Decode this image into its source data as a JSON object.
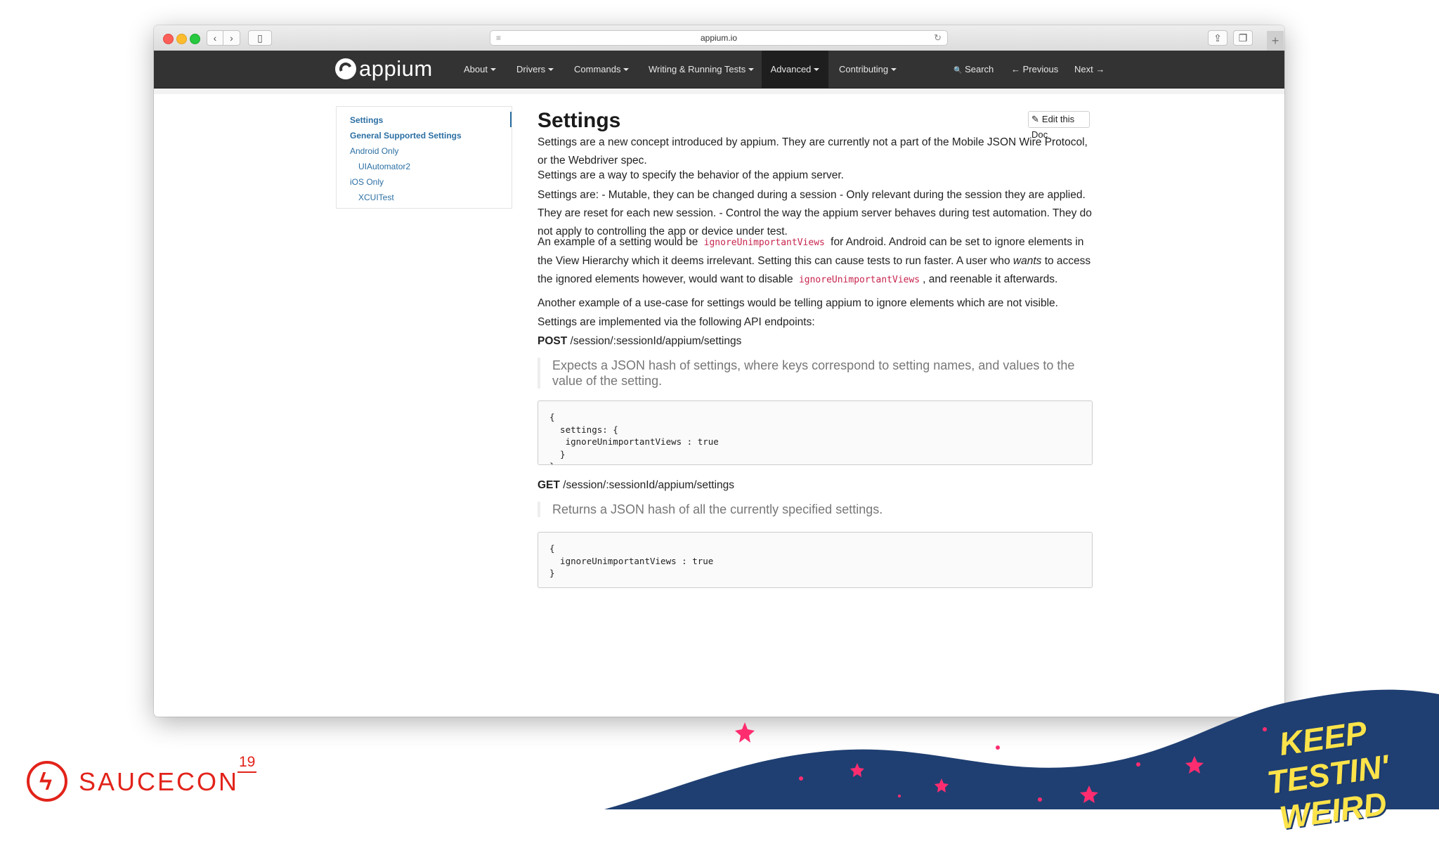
{
  "browser": {
    "url": "appium.io",
    "back_glyph": "‹",
    "forward_glyph": "›",
    "sidebar_glyph": "▯",
    "share_glyph": "⇪",
    "tabs_glyph": "❐",
    "newtab_glyph": "+",
    "reader_glyph": "≡",
    "reload_glyph": "↻"
  },
  "nav": {
    "logo": "appium",
    "items": [
      "About",
      "Drivers",
      "Commands",
      "Writing & Running Tests",
      "Advanced",
      "Contributing"
    ],
    "search": "Search",
    "previous": "Previous",
    "next": "Next",
    "search_glyph": "🔍",
    "previous_glyph": "←",
    "next_glyph": "→"
  },
  "toc": {
    "items": [
      "Settings",
      "General Supported Settings",
      "Android Only",
      "UIAutomator2",
      "iOS Only",
      "XCUITest"
    ]
  },
  "doc": {
    "title": "Settings",
    "edit_label": "Edit this Doc",
    "edit_glyph": "✎",
    "p1": "Settings are a new concept introduced by appium. They are currently not a part of the Mobile JSON Wire Protocol, or the Webdriver spec.",
    "p2": "Settings are a way to specify the behavior of the appium server.",
    "p3": "Settings are: - Mutable, they can be changed during a session - Only relevant during the session they are applied. They are reset for each new session. - Control the way the appium server behaves during test automation. They do not apply to controlling the app or device under test.",
    "p4": {
      "part1": "An example of a setting would be",
      "code1": "ignoreUnimportantViews",
      "part2": "for Android. Android can be set to ignore elements in the View Hierarchy which it deems irrelevant. Setting this can cause tests to run faster. A user who",
      "em": "wants",
      "part3": "to access the ignored elements however, would want to disable",
      "code2": "ignoreUnimportantViews",
      "part4": ", and reenable it afterwards."
    },
    "p5": "Another example of a use-case for settings would be telling appium to ignore elements which are not visible.",
    "p6": "Settings are implemented via the following API endpoints:",
    "post_method": "POST",
    "post_path": "/session/:sessionId/appium/settings",
    "post_quote": "Expects a JSON hash of settings, where keys correspond to setting names, and values to the value of the setting.",
    "post_code": "{\n  settings: {\n   ignoreUnimportantViews : true\n  }\n}",
    "get_method": "GET",
    "get_path": "/session/:sessionId/appium/settings",
    "get_quote": "Returns a JSON hash of all the currently specified settings.",
    "get_code": "{\n  ignoreUnimportantViews : true\n}"
  },
  "branding": {
    "saucecon": "SAUCECON",
    "year": "19",
    "bolt": "ϟ",
    "tagline_line1": "KEEP TESTIN'",
    "tagline_line2": "WEIRD",
    "colors": {
      "sauce_red": "#e2231a",
      "wave_navy": "#1f3f72",
      "star_pink": "#ff2d6f",
      "tagline_yellow": "#fce34a"
    }
  }
}
